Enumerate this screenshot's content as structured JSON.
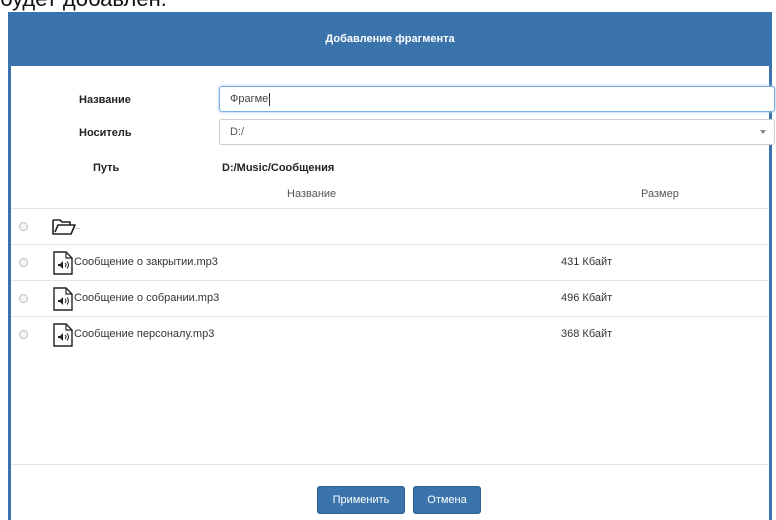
{
  "background": {
    "text": "будет добавлен."
  },
  "dialog": {
    "title": "Добавление фрагмента",
    "name_label": "Название",
    "name_value": "Фрагме",
    "media_label": "Носитель",
    "media_value": "D:/",
    "path_label": "Путь",
    "path_value": "D:/Music/Сообщения",
    "columns": {
      "name": "Название",
      "size": "Размер"
    },
    "parent_dir": "..",
    "files": [
      {
        "name": "Сообщение о закрытии.mp3",
        "size": "431 Кбайт"
      },
      {
        "name": "Сообщение о собрании.mp3",
        "size": "496 Кбайт"
      },
      {
        "name": "Сообщение персоналу.mp3",
        "size": "368 Кбайт"
      }
    ],
    "apply_label": "Применить",
    "cancel_label": "Отмена"
  },
  "colors": {
    "accent": "#3b73ad",
    "focus_border": "#7aaee0"
  },
  "icons": {
    "folder": "folder-open-icon",
    "file": "audio-file-icon",
    "dropdown": "chevron-down-icon"
  }
}
